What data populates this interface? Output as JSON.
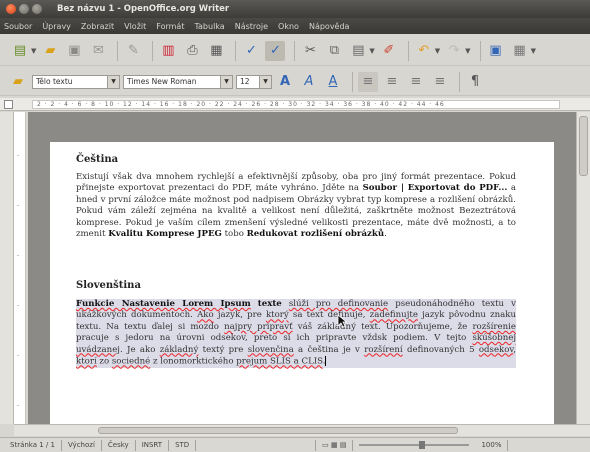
{
  "window": {
    "title": "Bez názvu 1 - OpenOffice.org Writer"
  },
  "menubar": {
    "items": [
      "Soubor",
      "Úpravy",
      "Zobrazit",
      "Vložit",
      "Formát",
      "Tabulka",
      "Nástroje",
      "Okno",
      "Nápověda"
    ]
  },
  "toolbar2": {
    "style_value": "Tělo textu",
    "font_value": "Times New Roman",
    "size_value": "12"
  },
  "ruler": {
    "ticks": "2 · 2 · 4 · 6 · 8 · 10 · 12 · 14 · 16 · 18 · 20 · 22 · 24 · 26 · 28 · 30 · 32 · 34 · 36 · 38 · 40 · 42 · 44 · 46"
  },
  "document": {
    "heading1": "Čeština",
    "para1_before1": "Existují však dva mnohem rychlejší a efektivnější způsoby, oba pro jiný formát prezentace. Pokud přinejste exportovat prezentaci do PDF, máte vyhráno. Jděte na ",
    "para1_bold1": "Soubor | Exportovat do PDF...",
    "para1_mid": " a hned v první záložce máte možnost pod nadpisem Obrázky vybrat typ komprese a rozlišení obrázků. Pokud vám záleží zejména na kvalitě a velikost není důležitá, zaškrtněte možnost Bezeztrátová komprese. Pokud je vaším cílem zmenšení výsledné velikosti prezentace, máte dvě možnosti, a to zmenit ",
    "para1_bold2": "Kvalitu Komprese JPEG",
    "para1_tobo": " tobo ",
    "para1_bold3": "Redukovat rozlišení obrázků",
    "para1_end": ".",
    "heading2": "Slovenština",
    "para2_bold": "Funkcie Nastavenie Lorem Ipsum",
    "para2_plain_a": " ",
    "para2_bold_b": "texte",
    "para2_a": " ",
    "para2_err1": "slúži pro definovanie",
    "para2_b": " pseudonáhodného textu v ukážkových dokumentoch. ",
    "para2_err2": "Ako",
    "para2_c": " jazyk, pre ",
    "para2_err3": "ktorý",
    "para2_d": " sa text definuje, ",
    "para2_err4": "zadefinujte",
    "para2_e": " jazyk pôvodnu znaku textu. Na textu ďalej si mozdo ",
    "para2_err5": "najpry pripravť",
    "para2_f": " váš základný text. Upozorňujeme, že ",
    "para2_err6": "rozšírenie",
    "para2_g": " pracuje s jedoru na úrovni odsekov, preto si ich pripravte vždsk podiem. V tejto ",
    "para2_err7": "skúšobnej uvádzanej",
    "para2_h": ". Je ako ",
    "para2_err8": "základný",
    "para2_i": " textý pre ",
    "para2_err9": "slovenčina",
    "para2_j": " a čeština je v ",
    "para2_err10": "rozšírení",
    "para2_k": " definovaných 5 ",
    "para2_err11": "odsekov",
    "para2_l": ", ",
    "para2_err12": "ktorí",
    "para2_m": " zo ",
    "para2_err13": "sociedné",
    "para2_n": " z lonomorktického ",
    "para2_err14": "prejum SLIS a CLIS",
    "para2_end": "."
  },
  "statusbar": {
    "page": "Stránka 1 / 1",
    "style": "Výchozí",
    "lang": "Česky",
    "insert_mode": "INSRT",
    "selection": "STD",
    "zoom": "100%"
  }
}
